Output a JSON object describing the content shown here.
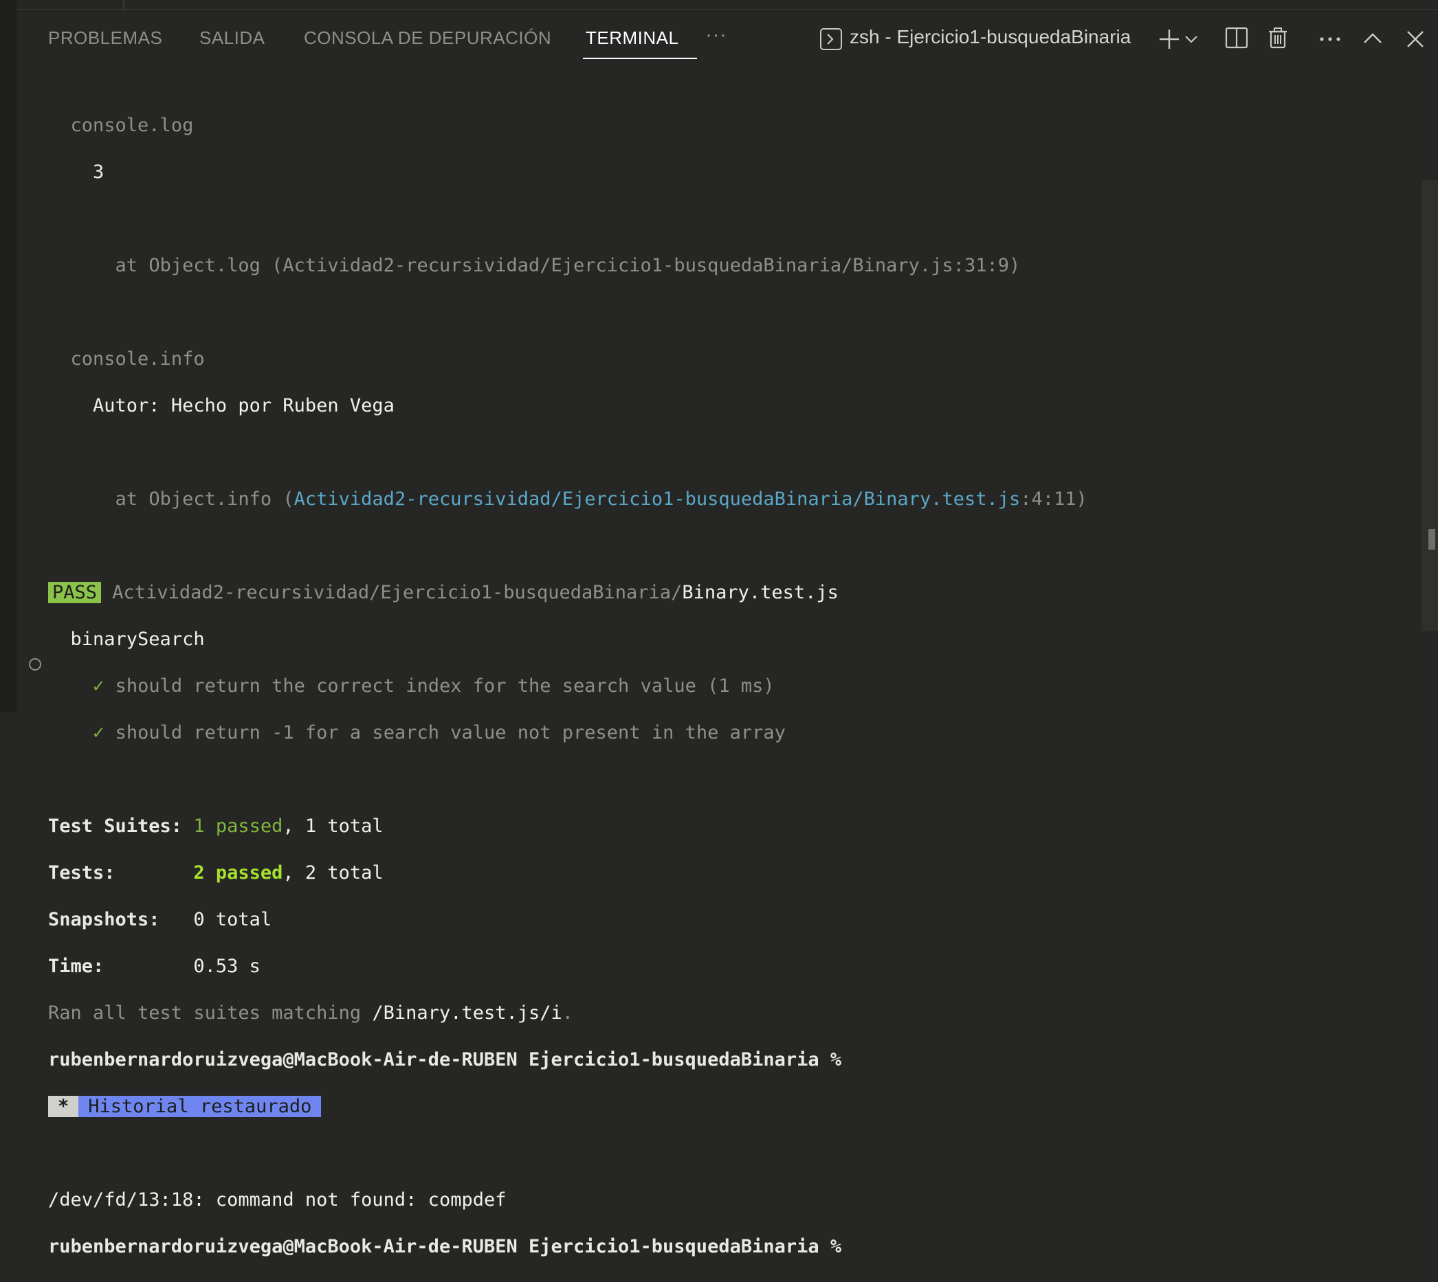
{
  "tabs": [
    {
      "label": "PROBLEMAS"
    },
    {
      "label": "SALIDA"
    },
    {
      "label": "CONSOLA DE DEPURACIÓN"
    },
    {
      "label": "TERMINAL",
      "active": true
    }
  ],
  "more_tabs_label": "···",
  "terminal_instance": "zsh - Ejercicio1-busquedaBinaria",
  "icons": [
    "terminal-icon",
    "plus-icon",
    "chevron-down-icon",
    "split-icon",
    "trash-icon",
    "more-icon",
    "chevron-up-icon",
    "close-icon"
  ],
  "output": {
    "log1_label": "console.log",
    "log1_value": "3",
    "log1_at": "at Object.log (Actividad2-recursividad/Ejercicio1-busquedaBinaria/Binary.js:31:9)",
    "info_label": "console.info",
    "info_value": "Autor: Hecho por Ruben Vega",
    "info_at_prefix": "at Object.info (",
    "info_at_path": "Actividad2-recursividad/Ejercicio1-busquedaBinaria/Binary.test.js",
    "info_at_suffix": ":4:11)",
    "pass_badge": "PASS",
    "pass_dir": "Actividad2-recursividad/Ejercicio1-busquedaBinaria/",
    "pass_file": "Binary.test.js",
    "suite_name": "binarySearch",
    "tests": [
      {
        "check": "✓",
        "name": "should return the correct index for the search value (1 ms)"
      },
      {
        "check": "✓",
        "name": "should return -1 for a search value not present in the array"
      }
    ],
    "summary": {
      "suites_label": "Test Suites:",
      "suites_passed": "1 passed",
      "suites_total": ", 1 total",
      "tests_label": "Tests:",
      "tests_passed": "2 passed",
      "tests_total": ", 2 total",
      "snapshots_label": "Snapshots:",
      "snapshots_value": "0 total",
      "time_label": "Time:",
      "time_value": "0.53 s"
    },
    "ran_prefix": "Ran all test suites matching ",
    "ran_pattern": "/Binary.test.js/i",
    "ran_suffix": ".",
    "prompt": "rubenbernardoruizvega@MacBook-Air-de-RUBEN Ejercicio1-busquedaBinaria %",
    "restore_star": "*",
    "restore_text": "Historial restaurado",
    "error_line": "/dev/fd/13:18: command not found: compdef",
    "prompt2": "rubenbernardoruizvega@MacBook-Air-de-RUBEN Ejercicio1-busquedaBinaria %"
  }
}
